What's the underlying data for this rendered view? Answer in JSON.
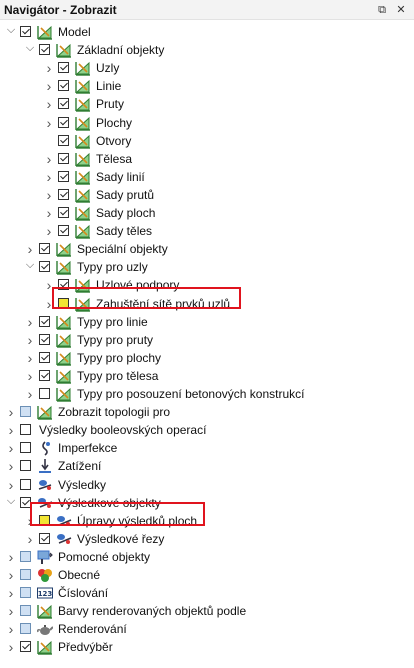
{
  "panel": {
    "title": "Navigátor - Zobrazit",
    "restore_glyph": "⧉",
    "close_glyph": "✕"
  },
  "tree": [
    {
      "label": "Model",
      "level": 0,
      "expander": "open",
      "check": "checked",
      "icon": "model-icon"
    },
    {
      "label": "Základní objekty",
      "level": 1,
      "expander": "open",
      "check": "checked",
      "icon": "model-icon"
    },
    {
      "label": "Uzly",
      "level": 2,
      "expander": "closed",
      "check": "checked",
      "icon": "model-icon"
    },
    {
      "label": "Linie",
      "level": 2,
      "expander": "closed",
      "check": "checked",
      "icon": "model-icon"
    },
    {
      "label": "Pruty",
      "level": 2,
      "expander": "closed",
      "check": "checked",
      "icon": "model-icon"
    },
    {
      "label": "Plochy",
      "level": 2,
      "expander": "closed",
      "check": "checked",
      "icon": "model-icon"
    },
    {
      "label": "Otvory",
      "level": 2,
      "expander": "none",
      "check": "checked",
      "icon": "model-icon"
    },
    {
      "label": "Tělesa",
      "level": 2,
      "expander": "closed",
      "check": "checked",
      "icon": "model-icon"
    },
    {
      "label": "Sady linií",
      "level": 2,
      "expander": "closed",
      "check": "checked",
      "icon": "model-icon"
    },
    {
      "label": "Sady prutů",
      "level": 2,
      "expander": "closed",
      "check": "checked",
      "icon": "model-icon"
    },
    {
      "label": "Sady ploch",
      "level": 2,
      "expander": "closed",
      "check": "checked",
      "icon": "model-icon"
    },
    {
      "label": "Sady těles",
      "level": 2,
      "expander": "closed",
      "check": "checked",
      "icon": "model-icon"
    },
    {
      "label": "Speciální objekty",
      "level": 1,
      "expander": "closed",
      "check": "checked",
      "icon": "model-icon"
    },
    {
      "label": "Typy pro uzly",
      "level": 1,
      "expander": "open",
      "check": "checked",
      "icon": "model-icon"
    },
    {
      "label": "Uzlové podpory",
      "level": 2,
      "expander": "closed",
      "check": "checked",
      "icon": "model-icon"
    },
    {
      "label": "Zahuštění sítě prvků uzlů",
      "level": 2,
      "expander": "closed",
      "check": "yellow",
      "icon": "model-icon"
    },
    {
      "label": "Typy pro linie",
      "level": 1,
      "expander": "closed",
      "check": "checked",
      "icon": "model-icon"
    },
    {
      "label": "Typy pro pruty",
      "level": 1,
      "expander": "closed",
      "check": "checked",
      "icon": "model-icon"
    },
    {
      "label": "Typy pro plochy",
      "level": 1,
      "expander": "closed",
      "check": "checked",
      "icon": "model-icon"
    },
    {
      "label": "Typy pro tělesa",
      "level": 1,
      "expander": "closed",
      "check": "checked",
      "icon": "model-icon"
    },
    {
      "label": "Typy pro posouzení betonových konstrukcí",
      "level": 1,
      "expander": "closed",
      "check": "unchecked",
      "icon": "model-icon"
    },
    {
      "label": "Zobrazit topologii pro",
      "level": 0,
      "expander": "closed",
      "check": "partial",
      "icon": "model-icon"
    },
    {
      "label": "Výsledky booleovských operací",
      "level": 0,
      "expander": "closed",
      "check": "unchecked",
      "icon": "none"
    },
    {
      "label": "Imperfekce",
      "level": 0,
      "expander": "closed",
      "check": "unchecked",
      "icon": "imperfection-icon"
    },
    {
      "label": "Zatížení",
      "level": 0,
      "expander": "closed",
      "check": "unchecked",
      "icon": "load-icon"
    },
    {
      "label": "Výsledky",
      "level": 0,
      "expander": "closed",
      "check": "unchecked",
      "icon": "results-icon"
    },
    {
      "label": "Výsledkové objekty",
      "level": 0,
      "expander": "open",
      "check": "checked",
      "icon": "result-object-icon"
    },
    {
      "label": "Úpravy výsledků ploch",
      "level": 1,
      "expander": "closed",
      "check": "yellow",
      "icon": "result-object-icon"
    },
    {
      "label": "Výsledkové řezy",
      "level": 1,
      "expander": "closed",
      "check": "checked",
      "icon": "result-object-icon"
    },
    {
      "label": "Pomocné objekty",
      "level": 0,
      "expander": "closed",
      "check": "partial",
      "icon": "guide-object-icon"
    },
    {
      "label": "Obecné",
      "level": 0,
      "expander": "closed",
      "check": "partial",
      "icon": "general-icon"
    },
    {
      "label": "Číslování",
      "level": 0,
      "expander": "closed",
      "check": "partial",
      "icon": "numbering-icon"
    },
    {
      "label": "Barvy renderovaných objektů podle",
      "level": 0,
      "expander": "closed",
      "check": "partial",
      "icon": "model-icon"
    },
    {
      "label": "Renderování",
      "level": 0,
      "expander": "closed",
      "check": "partial",
      "icon": "teapot-icon"
    },
    {
      "label": "Předvýběr",
      "level": 0,
      "expander": "closed",
      "check": "checked",
      "icon": "model-icon"
    }
  ],
  "numbering_icon_text": "123",
  "colors": {
    "highlight_border": "#e0141e",
    "yellow_check": "#f2e534"
  }
}
